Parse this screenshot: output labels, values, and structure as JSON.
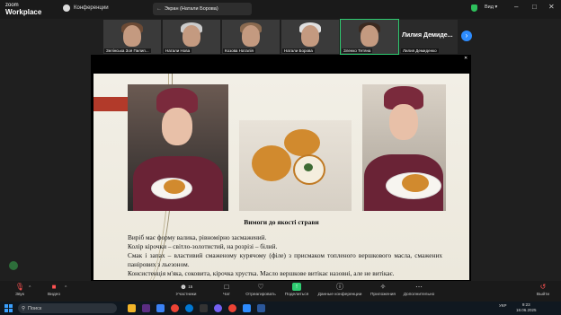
{
  "app": {
    "logo_line1": "zoom",
    "logo_line2": "Workplace",
    "conferences_label": "Конференции",
    "view_label": "Вид"
  },
  "share_tab": {
    "title": "Экран (Натали Борова)"
  },
  "participants": [
    {
      "name": "Зелінська Зоя Пилип..."
    },
    {
      "name": "Натали Нова"
    },
    {
      "name": "Козова Наталія"
    },
    {
      "name": "Натали Борова"
    },
    {
      "name": "Зленко Тетяна",
      "active": true
    },
    {
      "name": "Лилия Демиденко",
      "big_name": "Лилия Демиде..."
    }
  ],
  "slide": {
    "title": "Вимоги до якості страви",
    "lines": [
      "Виріб має форму валика, рівномірно засмажений.",
      "Колір кірочки – світло-золотистий, на розрізі – білий.",
      "Смак і запах – властивий смаженому курячому (філе) з присмаком топленого вершкового масла, смажених панірових з льезоном.",
      "Консистенція м'яка, соковита, кірочка хрустка. Масло вершкове витікає назовні, але не витікає."
    ]
  },
  "toolbar": {
    "audio": "Звук",
    "video": "Видео",
    "participants": "Участники",
    "participants_count": "15",
    "chat": "Чат",
    "react": "Отреагировать",
    "share": "Поделиться",
    "info": "Данные конференции",
    "reactions": "Приложения",
    "more": "Дополнительно",
    "leave": "Выйти"
  },
  "taskbar": {
    "search_placeholder": "Поиск",
    "lang": "УКР",
    "time": "9:23",
    "date": "18.06.2025"
  },
  "colors": {
    "accent": "#2d8cff",
    "share_green": "#2ecc71",
    "leave_red": "#ff5252",
    "slide_bar": "#b23a2a"
  }
}
